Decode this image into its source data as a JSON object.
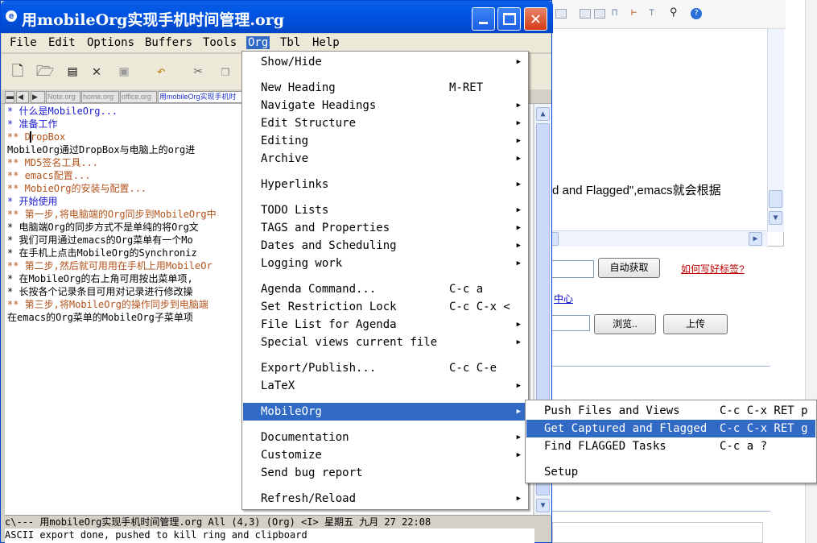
{
  "window": {
    "title": "用mobileOrg实现手机时间管理.org",
    "title_icon": "emacs-icon",
    "controls": {
      "minimize": "minimize-icon",
      "maximize": "maximize-icon",
      "close": "close-icon"
    }
  },
  "menubar": {
    "items": [
      "File",
      "Edit",
      "Options",
      "Buffers",
      "Tools",
      "Org",
      "Tbl",
      "Help"
    ],
    "active": "Org"
  },
  "toolbar": {
    "icons": [
      "new-file-icon",
      "open-folder-icon",
      "save-document-icon",
      "close-icon",
      "save-disk-icon",
      "undo-icon",
      "cut-icon",
      "copy-icon"
    ]
  },
  "tabs": [
    "Note.org",
    "home.org",
    "office.org",
    "用mobileOrg实现手机时"
  ],
  "buffer": {
    "lines": [
      {
        "text": "* 什么是MobileOrg...",
        "color": "#1a1ad0"
      },
      {
        "text": "* 准备工作",
        "color": "#1a1ad0"
      },
      {
        "text": "** DropBox",
        "color": "#b3531c"
      },
      {
        "text": "   MobileOrg通过DropBox与电脑上的org进",
        "color": "#000000"
      },
      {
        "text": "** MD5签名工具...",
        "color": "#b3531c"
      },
      {
        "text": "** emacs配置...",
        "color": "#b3531c"
      },
      {
        "text": "** MobieOrg的安装与配置...",
        "color": "#b3531c"
      },
      {
        "text": "* 开始使用",
        "color": "#1a1ad0"
      },
      {
        "text": "** 第一步,将电脑端的Org同步到MobileOrg中",
        "color": "#b3531c"
      },
      {
        "text": "   * 电脑端Org的同步方式不是单纯的将Org文",
        "color": "#000000"
      },
      {
        "text": "   * 我们可用通过emacs的Org菜单有一个Mo",
        "color": "#000000"
      },
      {
        "text": "   * 在手机上点击MobileOrg的Synchroniz",
        "color": "#000000"
      },
      {
        "text": "** 第二步,然后就可用用在手机上用MobileOr",
        "color": "#b3531c"
      },
      {
        "text": "   * 在MobileOrg的右上角可用按出菜单项,",
        "color": "#000000"
      },
      {
        "text": "   * 长按各个记录条目可用对记录进行修改操",
        "color": "#000000"
      },
      {
        "text": "** 第三步,将MobileOrg的操作同步到电脑端",
        "color": "#b3531c"
      },
      {
        "text": "   在emacs的Org菜单的MobileOrg子菜单项",
        "color": "#000000"
      }
    ]
  },
  "modeline": "c\\---  用mobileOrg实现手机时间管理.org   All (4,3)     (Org) <I> 星期五 九月 27 22:08",
  "minibuffer": "ASCII export done, pushed to kill ring and clipboard",
  "org_menu": {
    "groups": [
      [
        {
          "label": "Show/Hide",
          "submenu": true
        }
      ],
      [
        {
          "label": "New Heading",
          "accel": "M-RET"
        },
        {
          "label": "Navigate Headings",
          "submenu": true
        },
        {
          "label": "Edit Structure",
          "submenu": true
        },
        {
          "label": "Editing",
          "submenu": true
        },
        {
          "label": "Archive",
          "submenu": true
        }
      ],
      [
        {
          "label": "Hyperlinks",
          "submenu": true
        }
      ],
      [
        {
          "label": "TODO Lists",
          "submenu": true
        },
        {
          "label": "TAGS and Properties",
          "submenu": true
        },
        {
          "label": "Dates and Scheduling",
          "submenu": true
        },
        {
          "label": "Logging work",
          "submenu": true
        }
      ],
      [
        {
          "label": "Agenda Command...",
          "accel": "C-c a"
        },
        {
          "label": "Set Restriction Lock",
          "accel": "C-c C-x <"
        },
        {
          "label": "File List for Agenda",
          "submenu": true
        },
        {
          "label": "Special views current file",
          "submenu": true
        }
      ],
      [
        {
          "label": "Export/Publish...",
          "accel": "C-c C-e"
        },
        {
          "label": "LaTeX",
          "submenu": true
        }
      ],
      [
        {
          "label": "MobileOrg",
          "submenu": true,
          "selected": true
        }
      ],
      [
        {
          "label": "Documentation",
          "submenu": true
        },
        {
          "label": "Customize",
          "submenu": true
        },
        {
          "label": "Send bug report"
        }
      ],
      [
        {
          "label": "Refresh/Reload",
          "submenu": true
        }
      ]
    ]
  },
  "mobileorg_submenu": {
    "items": [
      {
        "label": "Push Files and Views",
        "accel": "C-c C-x RET p"
      },
      {
        "label": "Get Captured and Flagged",
        "accel": "C-c C-x RET g",
        "selected": true
      },
      {
        "label": "Find FLAGGED Tasks",
        "accel": "C-c a ?"
      },
      {
        "separator": true
      },
      {
        "label": "Setup"
      }
    ]
  },
  "background_page": {
    "text": "d and Flagged\",emacs就会根据",
    "auto_fetch_button": "自动获取",
    "tag_help_link": "如何写好标签?",
    "center_link": "中心",
    "browse_button": "浏览..",
    "upload_button": "上传"
  }
}
